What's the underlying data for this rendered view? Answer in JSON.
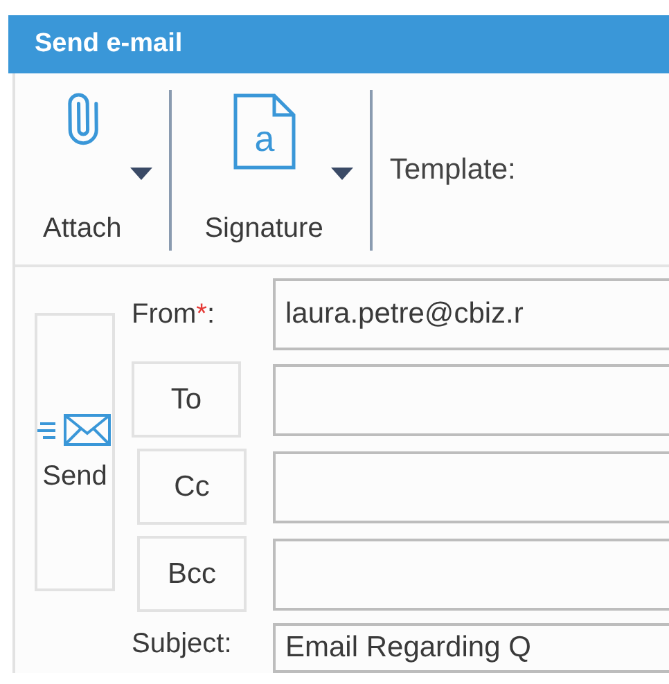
{
  "window": {
    "title": "Send e-mail"
  },
  "toolbar": {
    "buttons": [
      {
        "kind": "attach",
        "label": "Attach",
        "has_dropdown": true
      },
      {
        "kind": "signature",
        "label": "Signature",
        "icon_text": "a",
        "has_dropdown": true
      }
    ],
    "template_label": "Template:"
  },
  "form": {
    "send_button": "Send",
    "from": {
      "label": "From",
      "required_mark": "*",
      "colon": ":",
      "value": "laura.petre@cbiz.r"
    },
    "recipients": [
      {
        "label": "To"
      },
      {
        "label": "Cc"
      },
      {
        "label": "Bcc"
      }
    ],
    "subject": {
      "label": "Subject:",
      "value": "Email Regarding Q"
    }
  }
}
